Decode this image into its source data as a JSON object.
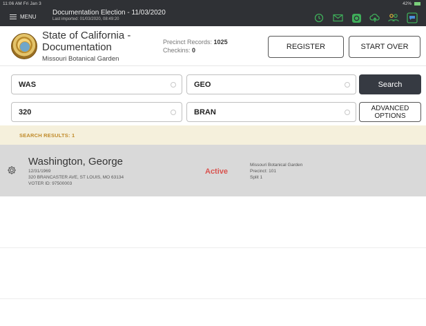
{
  "status_bar": {
    "time": "11:06 AM",
    "date": "Fri Jan 3",
    "battery": "42%"
  },
  "topbar": {
    "menu_label": "MENU",
    "title": "Documentation Election - 11/03/2020",
    "last_imported": "Last imported: 01/03/2020, 08:49:20",
    "icons": [
      "history-icon",
      "mail-icon",
      "sync-icon",
      "cloud-upload-icon",
      "users-icon",
      "chat-icon"
    ]
  },
  "header": {
    "org_name": "State of California - Documentation",
    "org_sub": "Missouri Botanical Garden",
    "precinct_records_label": "Precinct Records:",
    "precinct_records_value": "1025",
    "checkins_label": "Checkins:",
    "checkins_value": "0",
    "register_label": "REGISTER",
    "start_over_label": "START OVER"
  },
  "search": {
    "last_name": "WAS",
    "first_name": "GEO",
    "house_number": "320",
    "street": "BRAN",
    "search_label": "Search",
    "advanced_label_line1": "ADVANCED",
    "advanced_label_line2": "OPTIONS"
  },
  "results": {
    "label": "SEARCH RESULTS: 1",
    "items": [
      {
        "name": "Washington, George",
        "dob": "12/31/1969",
        "address": "320 BRANCASTER AVE, ST LOUIS, MO 63134",
        "voter_id": "VOTER ID: 97500003",
        "status": "Active",
        "poll_place": "Missouri Botanical Garden",
        "precinct": "Precinct: 101",
        "split": "Split 1"
      }
    ]
  },
  "colors": {
    "topbar_bg": "#2f3135",
    "accent_green": "#3fae5a",
    "search_button_bg": "#363a42",
    "results_bar_bg": "#f5f0dc",
    "results_label": "#c08a2a",
    "status_active": "#d9534f",
    "row_bg": "#d9d9d9"
  }
}
